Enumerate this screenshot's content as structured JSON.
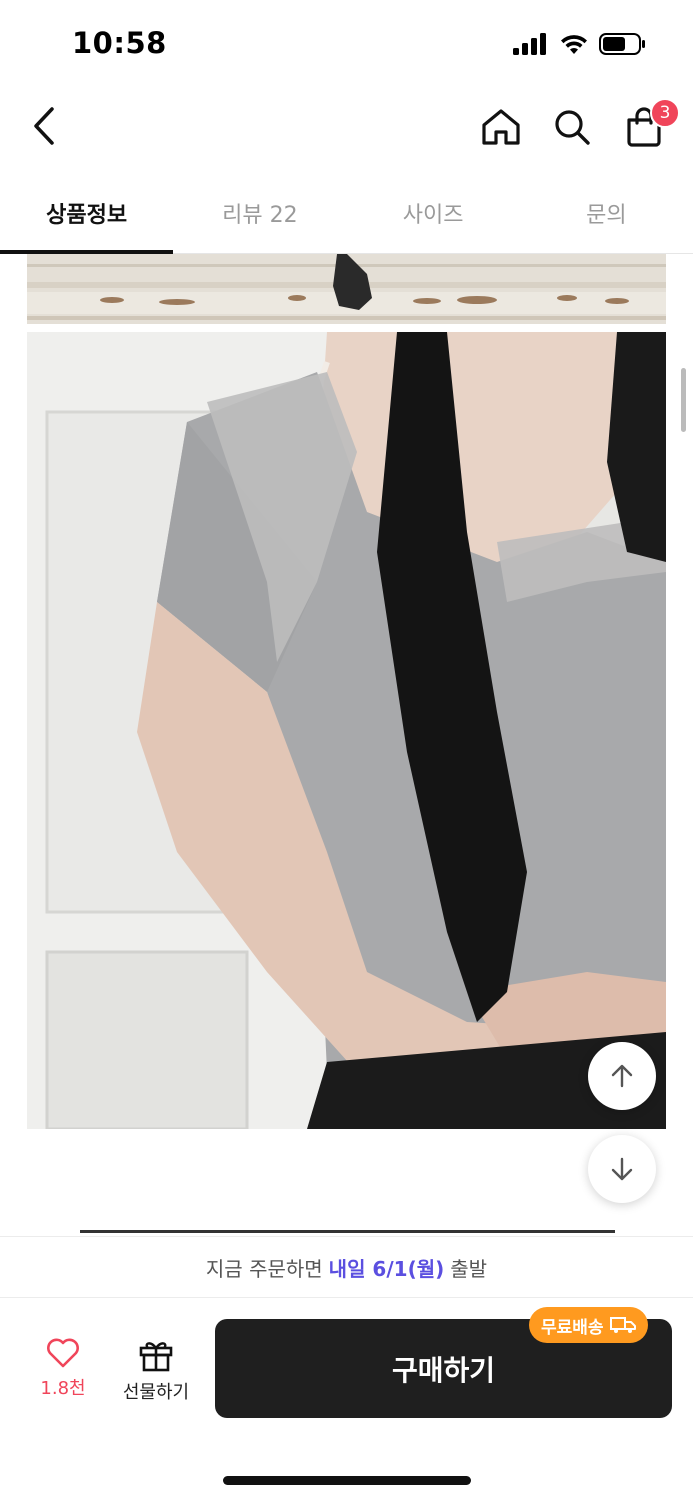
{
  "status_bar": {
    "time": "10:58"
  },
  "header": {
    "cart_count": "3"
  },
  "tabs": [
    {
      "label": "상품정보",
      "active": true
    },
    {
      "label": "리뷰 22",
      "active": false
    },
    {
      "label": "사이즈",
      "active": false
    },
    {
      "label": "문의",
      "active": false
    }
  ],
  "delivery": {
    "prefix": "지금 주문하면",
    "highlight": "내일 6/1(월)",
    "suffix": "출발"
  },
  "bottom_bar": {
    "like_count": "1.8천",
    "gift_label": "선물하기",
    "buy_label": "구매하기",
    "free_shipping_label": "무료배송"
  },
  "colors": {
    "accent_red": "#f0455a",
    "highlight_purple": "#5b4fe0",
    "buy_button": "#1f1f1f",
    "free_ship_badge": "#ff9a1f"
  }
}
